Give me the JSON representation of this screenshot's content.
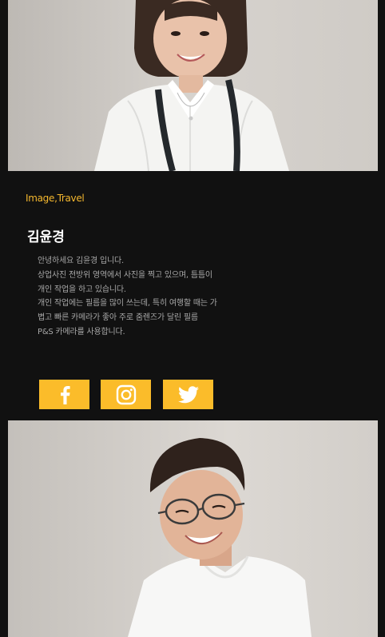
{
  "profile": {
    "category": "Image,Travel",
    "name": "김윤경",
    "bio_lines": [
      "안녕하세요 김윤경 입니다.",
      "상업사진 전방위 영역에서 사진을 찍고 있으며, 틈틈이",
      "개인 작업을 하고 있습니다.",
      "개인 작업에는 필름을 많이 쓰는데, 특히 여행할 때는 가",
      "볍고 빠른 카메라가 좋아 주로 줌렌즈가 달린 필름",
      "P&S 카메라를 사용합니다."
    ]
  },
  "social": [
    {
      "name": "facebook",
      "icon": "facebook-icon"
    },
    {
      "name": "instagram",
      "icon": "instagram-icon"
    },
    {
      "name": "twitter",
      "icon": "twitter-icon"
    }
  ],
  "colors": {
    "background": "#111111",
    "accent": "#fbbc2a",
    "category_text": "#f5b82e",
    "bio_text": "#a8a8a8"
  }
}
